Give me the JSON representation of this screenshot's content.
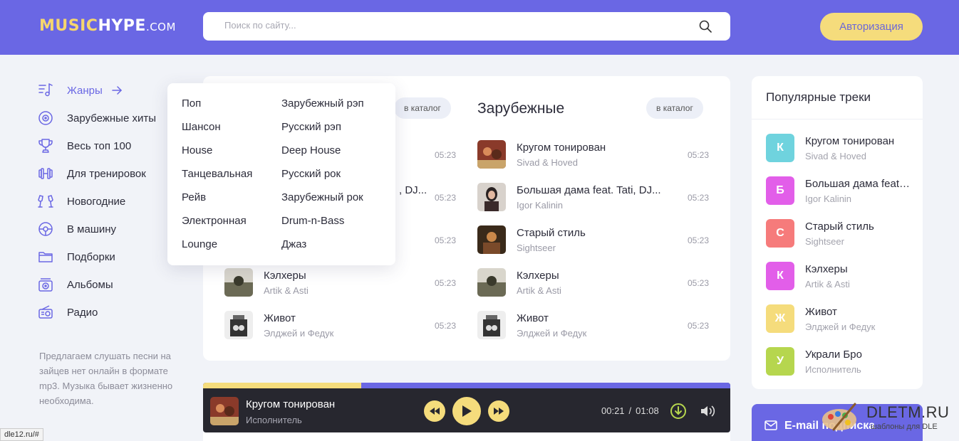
{
  "header": {
    "logo_part1": "MUSIC",
    "logo_part2": "HYPE",
    "logo_part3": ".COM",
    "search_placeholder": "Поиск по сайту...",
    "auth_label": "Авторизация"
  },
  "sidebar": {
    "items": [
      {
        "label": "Жанры",
        "icon": "music-list-icon"
      },
      {
        "label": "Зарубежные хиты",
        "icon": "disc-icon"
      },
      {
        "label": "Весь топ 100",
        "icon": "trophy-icon"
      },
      {
        "label": "Для тренировок",
        "icon": "dumbbell-icon"
      },
      {
        "label": "Новогодние",
        "icon": "champagne-icon"
      },
      {
        "label": "В машину",
        "icon": "steering-wheel-icon"
      },
      {
        "label": "Подборки",
        "icon": "folder-icon"
      },
      {
        "label": "Альбомы",
        "icon": "album-icon"
      },
      {
        "label": "Радио",
        "icon": "radio-icon"
      }
    ],
    "description": "Предлагаем слушать песни на зайцев нет онлайн в формате mp3. Музыка бывает жизненно необходима."
  },
  "main": {
    "left_catalog_label": "в каталог",
    "right_title": "Зарубежные",
    "right_catalog_label": "в каталог",
    "left_tracks": [
      {
        "name": "",
        "artist": "",
        "duration": "05:23"
      },
      {
        "name": ", DJ...",
        "artist": "",
        "duration": "05:23"
      },
      {
        "name": "",
        "artist": "",
        "duration": "05:23"
      },
      {
        "name": "Кэлхеры",
        "artist": "Artik & Asti",
        "duration": "05:23"
      },
      {
        "name": "Живот",
        "artist": "Элджей и Федук",
        "duration": "05:23"
      }
    ],
    "right_tracks": [
      {
        "name": "Кругом тонирован",
        "artist": "Sivad & Hoved",
        "duration": "05:23"
      },
      {
        "name": "Большая дама feat. Tati, DJ...",
        "artist": "Igor Kalinin",
        "duration": "05:23"
      },
      {
        "name": "Старый стиль",
        "artist": "Sightseer",
        "duration": "05:23"
      },
      {
        "name": "Кэлхеры",
        "artist": "Artik & Asti",
        "duration": "05:23"
      },
      {
        "name": "Живот",
        "artist": "Элджей и Федук",
        "duration": "05:23"
      }
    ]
  },
  "genres_dropdown": {
    "col1": [
      "Поп",
      "Шансон",
      "House",
      "Танцевальная",
      "Рейв",
      "Электронная",
      "Lounge"
    ],
    "col2": [
      "Зарубежный рэп",
      "Русский рэп",
      "Deep House",
      "Русский рок",
      "Зарубежный рок",
      "Drum-n-Bass",
      "Джаз"
    ]
  },
  "player": {
    "title": "Кругом тонирован",
    "artist": "Исполнитель",
    "current_time": "00:21",
    "separator": "/",
    "total_time": "01:08",
    "progress_fraction": 0.3
  },
  "popular": {
    "title": "Популярные треки",
    "items": [
      {
        "letter": "К",
        "name": "Кругом тонирован",
        "artist": "Sivad & Hoved",
        "color": "#6fd3de"
      },
      {
        "letter": "Б",
        "name": "Большая дама feat. Tati, DJ...",
        "artist": "Igor Kalinin",
        "color": "#e25ee9"
      },
      {
        "letter": "С",
        "name": "Старый стиль",
        "artist": "Sightseer",
        "color": "#f67b7b"
      },
      {
        "letter": "К",
        "name": "Кэлхеры",
        "artist": "Artik & Asti",
        "color": "#e25ee9"
      },
      {
        "letter": "Ж",
        "name": "Живот",
        "artist": "Элджей и Федук",
        "color": "#f5dc7c"
      },
      {
        "letter": "У",
        "name": "Украли Бро",
        "artist": "Исполнитель",
        "color": "#b6d64e"
      }
    ]
  },
  "subscribe": {
    "label": "E-mail подписка"
  },
  "watermark": {
    "name": "DLETM.RU",
    "subtitle": "шаблоны для DLE"
  },
  "status_url": "dle12.ru/#",
  "colors": {
    "accent": "#6a67e4",
    "yellow": "#f5dc7c"
  }
}
